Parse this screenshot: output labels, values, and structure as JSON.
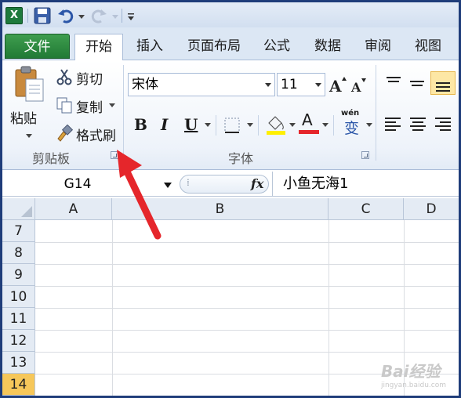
{
  "ribbon_tabs": [
    "文件",
    "开始",
    "插入",
    "页面布局",
    "公式",
    "数据",
    "审阅",
    "视图"
  ],
  "clipboard": {
    "paste": "粘贴",
    "cut": "剪切",
    "copy": "复制",
    "format_painter": "格式刷",
    "group_label": "剪贴板"
  },
  "font": {
    "name": "宋体",
    "size": "11",
    "bold": "B",
    "italic": "I",
    "underline": "U",
    "font_color_glyph": "A",
    "phonetic_glyph_top": "wén",
    "phonetic_glyph": "变",
    "group_label": "字体"
  },
  "formula_bar": {
    "name_box": "G14",
    "fx": "fx",
    "value": "小鱼无海1"
  },
  "sheet": {
    "columns": [
      "A",
      "B",
      "C",
      "D"
    ],
    "rows": [
      "7",
      "8",
      "9",
      "10",
      "11",
      "12",
      "13",
      "14"
    ],
    "selected_row": "14"
  },
  "colors": {
    "file_tab": "#217a35",
    "selected_header": "#f6c75a",
    "arrow": "#e5262b",
    "highlight_bar": "#ffef00",
    "font_color_bar": "#e5262b"
  },
  "watermark": {
    "brand": "Bai经验",
    "url": "jingyan.baidu.com"
  }
}
